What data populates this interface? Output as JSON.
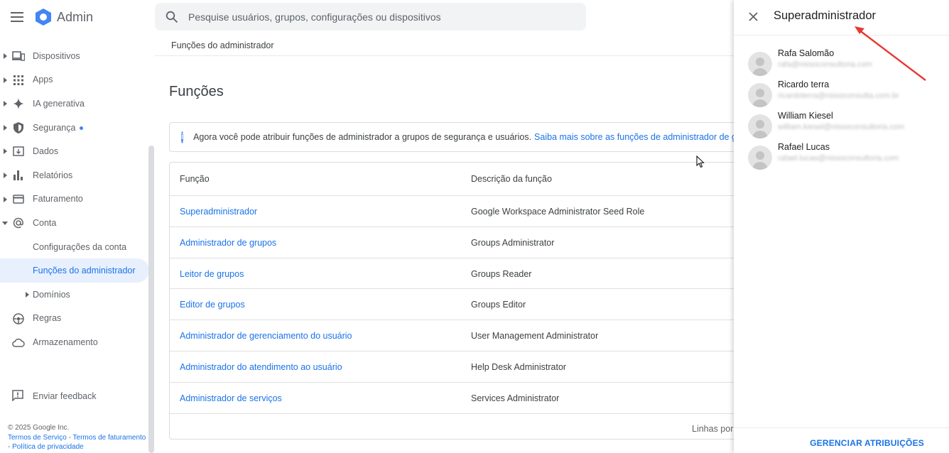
{
  "app": {
    "title": "Admin",
    "brand_color": "#1a73e8"
  },
  "search": {
    "placeholder": "Pesquise usuários, grupos, configurações ou dispositivos"
  },
  "breadcrumb": "Funções do administrador",
  "sidebar": {
    "items": [
      {
        "label": "Dispositivos",
        "icon": "devices-icon"
      },
      {
        "label": "Apps",
        "icon": "apps-grid-icon"
      },
      {
        "label": "IA generativa",
        "icon": "sparkle-icon"
      },
      {
        "label": "Segurança",
        "icon": "shield-icon"
      },
      {
        "label": "Dados",
        "icon": "data-folder-icon"
      },
      {
        "label": "Relatórios",
        "icon": "bar-chart-icon"
      },
      {
        "label": "Faturamento",
        "icon": "credit-card-icon"
      },
      {
        "label": "Conta",
        "icon": "at-sign-icon"
      },
      {
        "label": "Configurações da conta"
      },
      {
        "label": "Funções do administrador"
      },
      {
        "label": "Domínios"
      },
      {
        "label": "Regras",
        "icon": "rules-icon"
      },
      {
        "label": "Armazenamento",
        "icon": "cloud-icon"
      }
    ],
    "feedback": "Enviar feedback",
    "footer": {
      "copyright": "© 2025 Google Inc.",
      "tos": "Termos de Serviço",
      "billing_terms": "Termos de faturamento",
      "privacy": "Política de privacidade"
    }
  },
  "main": {
    "title": "Funções",
    "info": {
      "text": "Agora você pode atribuir funções de administrador a grupos de segurança e usuários.",
      "link": "Saiba mais sobre as funções de administrador de grupos"
    },
    "table": {
      "columns": [
        "Função",
        "Descrição da função"
      ],
      "rows": [
        {
          "role": "Superadministrador",
          "description": "Google Workspace Administrator Seed Role"
        },
        {
          "role": "Administrador de grupos",
          "description": "Groups Administrator"
        },
        {
          "role": "Leitor de grupos",
          "description": "Groups Reader"
        },
        {
          "role": "Editor de grupos",
          "description": "Groups Editor"
        },
        {
          "role": "Administrador de gerenciamento do usuário",
          "description": "User Management Administrator"
        },
        {
          "role": "Administrador do atendimento ao usuário",
          "description": "Help Desk Administrator"
        },
        {
          "role": "Administrador de serviços",
          "description": "Services Administrator"
        }
      ],
      "footer": "Linhas por"
    }
  },
  "panel": {
    "title": "Superadministrador",
    "members": [
      {
        "name": "Rafa Salomão",
        "email": "rafa@nissoconsultoria.com"
      },
      {
        "name": "Ricardo terra",
        "email": "ricardoterra@nissoconsulta.com.br"
      },
      {
        "name": "William Kiesel",
        "email": "william.kiesel@nissoconsultoria.com"
      },
      {
        "name": "Rafael Lucas",
        "email": "rafael.lucas@nissoconsultoria.com"
      }
    ],
    "manage": "GERENCIAR ATRIBUIÇÕES"
  }
}
